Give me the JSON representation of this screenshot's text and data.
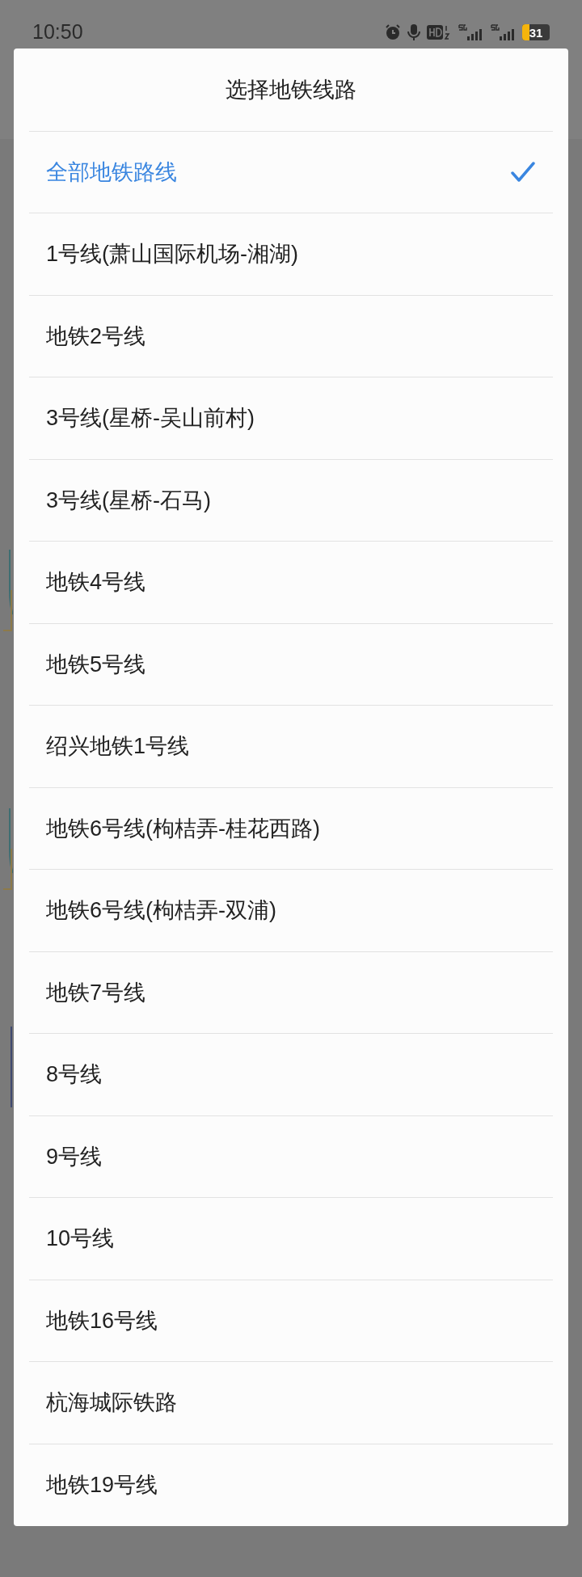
{
  "status_bar": {
    "time": "10:50",
    "battery": "31"
  },
  "dialog": {
    "title": "选择地铁线路",
    "items": [
      {
        "label": "全部地铁路线",
        "selected": true
      },
      {
        "label": "1号线(萧山国际机场-湘湖)",
        "selected": false
      },
      {
        "label": "地铁2号线",
        "selected": false
      },
      {
        "label": "3号线(星桥-吴山前村)",
        "selected": false
      },
      {
        "label": "3号线(星桥-石马)",
        "selected": false
      },
      {
        "label": "地铁4号线",
        "selected": false
      },
      {
        "label": "地铁5号线",
        "selected": false
      },
      {
        "label": "绍兴地铁1号线",
        "selected": false
      },
      {
        "label": "地铁6号线(枸桔弄-桂花西路)",
        "selected": false
      },
      {
        "label": "地铁6号线(枸桔弄-双浦)",
        "selected": false
      },
      {
        "label": "地铁7号线",
        "selected": false
      },
      {
        "label": "8号线",
        "selected": false
      },
      {
        "label": "9号线",
        "selected": false
      },
      {
        "label": "10号线",
        "selected": false
      },
      {
        "label": "地铁16号线",
        "selected": false
      },
      {
        "label": "杭海城际铁路",
        "selected": false
      },
      {
        "label": "地铁19号线",
        "selected": false
      }
    ]
  }
}
